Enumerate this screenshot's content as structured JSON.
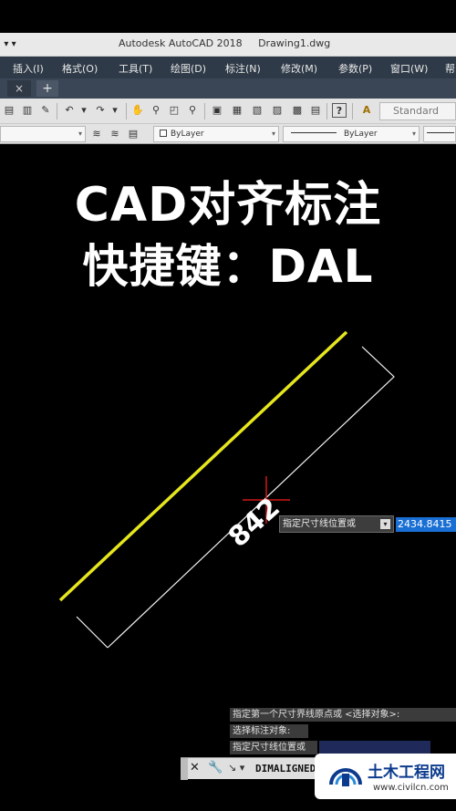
{
  "title_bar": {
    "quick_access": "▾ ▾",
    "title": "Autodesk AutoCAD 2018     Drawing1.dwg"
  },
  "menu": [
    "插入(I)",
    "格式(O)",
    "工具(T)",
    "绘图(D)",
    "标注(N)",
    "修改(M)",
    "参数(P)",
    "窗口(W)",
    "帮"
  ],
  "tabs": {
    "close": "×",
    "add": "+"
  },
  "toolbar": {
    "text_style": "Standard",
    "text_style_icon": "A"
  },
  "properties": {
    "color": "ByLayer",
    "linetype": "ByLayer"
  },
  "overlay": {
    "line1": "CAD对齐标注",
    "line2": "快捷键：DAL"
  },
  "drawing": {
    "dimension_text": "842",
    "line_color": "#e6e61e",
    "crosshair_color": "#d01818"
  },
  "dynamic_input": {
    "prompt": "指定尺寸线位置或",
    "value": "2434.8415"
  },
  "command_history": [
    "指定第一个尺寸界线原点或 <选择对象>:",
    "选择标注对象:",
    "指定尺寸线位置或"
  ],
  "command_line": {
    "command": "DIMALIGNED"
  },
  "watermark": {
    "name": "土木工程网",
    "url": "www.civilcn.com"
  }
}
